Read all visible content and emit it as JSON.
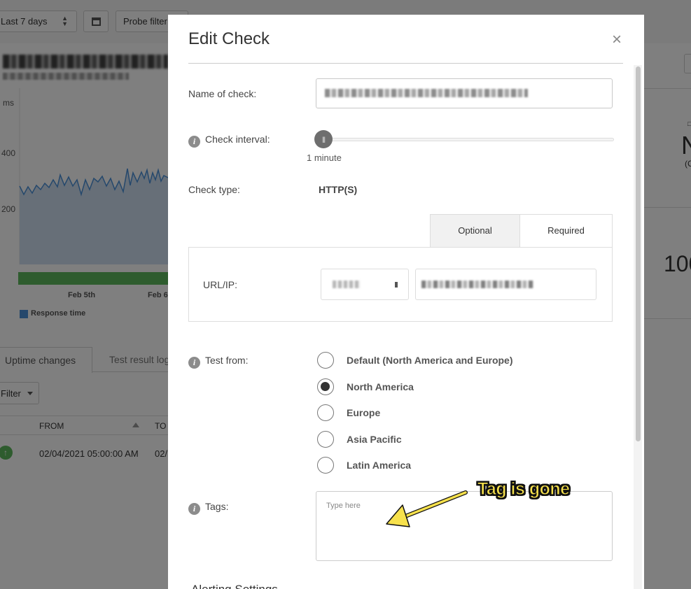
{
  "background": {
    "range_select": "Last 7 days",
    "probe_filter": "Probe filter",
    "chart": {
      "y_unit": "ms",
      "y_ticks": [
        "400",
        "200"
      ],
      "x_ticks": [
        "Feb 5th",
        "Feb 6"
      ],
      "legend": "Response time",
      "series_color": "#4a90d9",
      "uptime_color": "#5cb85c"
    },
    "tabs": [
      "Uptime changes",
      "Test result log"
    ],
    "filter_label": "Filter",
    "table": {
      "columns": [
        "FROM",
        "TO"
      ],
      "rows": [
        {
          "from": "02/04/2021 05:00:00 AM",
          "to": "02/"
        }
      ]
    },
    "right_stats": {
      "big_1": "N",
      "small_1": "(C",
      "big_2": "100"
    }
  },
  "modal": {
    "title": "Edit Check",
    "close": "×",
    "name_label": "Name of check:",
    "interval_label": "Check interval:",
    "interval_value": "1 minute",
    "interval_slider_level": 0,
    "check_type_label": "Check type:",
    "check_type_value": "HTTP(S)",
    "seg_tabs": {
      "optional": "Optional",
      "required": "Required",
      "active": "Required"
    },
    "url_label": "URL/IP:",
    "test_from_label": "Test from:",
    "regions": [
      {
        "label": "Default (North America and Europe)",
        "checked": false
      },
      {
        "label": "North America",
        "checked": true
      },
      {
        "label": "Europe",
        "checked": false
      },
      {
        "label": "Asia Pacific",
        "checked": false
      },
      {
        "label": "Latin America",
        "checked": false
      }
    ],
    "tags_label": "Tags:",
    "tags_placeholder": "Type here",
    "alerting_heading": "Alerting Settings"
  },
  "annotation": {
    "text": "Tag is gone",
    "color": "#f7e14c"
  }
}
